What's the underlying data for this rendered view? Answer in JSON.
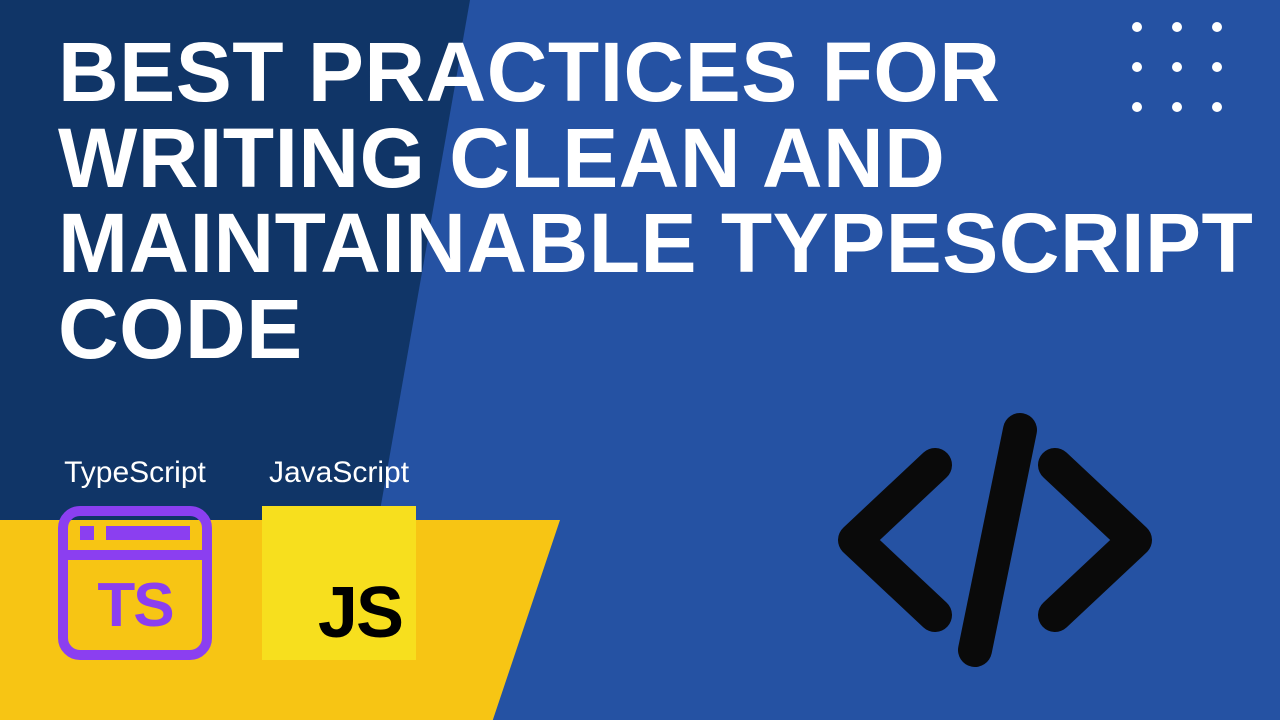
{
  "title": "BEST PRACTICES FOR WRITING CLEAN AND MAINTAINABLE TYPESCRIPT CODE",
  "langs": {
    "typescript": {
      "label": "TypeScript",
      "badge": "TS"
    },
    "javascript": {
      "label": "JavaScript",
      "badge": "JS"
    }
  },
  "colors": {
    "bg_main": "#2552a3",
    "bg_dark": "#103567",
    "yellow": "#f7c514",
    "js_yellow": "#f7df1e",
    "ts_purple": "#8b3ff0",
    "white": "#ffffff",
    "black": "#000000"
  },
  "icons": {
    "code": "code-icon",
    "dots": "dot-grid-icon"
  }
}
